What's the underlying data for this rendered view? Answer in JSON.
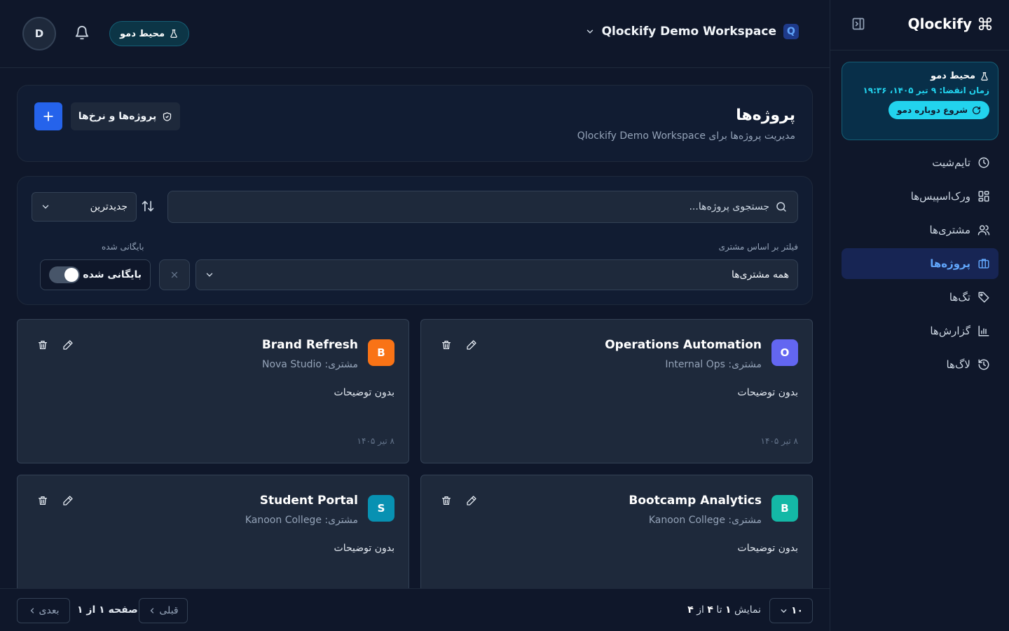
{
  "brand": {
    "name": "Qlockify"
  },
  "demo": {
    "title": "محیط دمو",
    "expiry": "زمان انقضا: ۹ تیر ۱۴۰۵، ۱۹:۳۶",
    "restart_label": "شروع دوباره دمو"
  },
  "nav": [
    {
      "label": "تایم‌شیت",
      "icon": "clock-icon"
    },
    {
      "label": "ورک‌اسپیس‌ها",
      "icon": "grid-icon"
    },
    {
      "label": "مشتری‌ها",
      "icon": "users-icon"
    },
    {
      "label": "پروژه‌ها",
      "icon": "briefcase-icon",
      "active": true
    },
    {
      "label": "تگ‌ها",
      "icon": "tag-icon"
    },
    {
      "label": "گزارش‌ها",
      "icon": "bar-chart-icon"
    },
    {
      "label": "لاگ‌ها",
      "icon": "history-icon"
    }
  ],
  "header": {
    "avatar_initial": "D",
    "demo_pill": "محیط دمو",
    "workspace_badge": "Q",
    "workspace_name": "Qlockify Demo Workspace"
  },
  "page": {
    "title": "پروژه‌ها",
    "subtitle": "مدیریت پروژه‌ها برای Qlockify Demo Workspace",
    "rates_button": "پروژه‌ها و نرخ‌ها"
  },
  "filters": {
    "search_placeholder": "جستجوی پروژه‌ها...",
    "sort_value": "جدیدترین",
    "client_label": "فیلتر بر اساس مشتری",
    "client_value": "همه مشتری‌ها",
    "archived_label": "بایگانی شده",
    "archived_toggle_label": "بایگانی شده"
  },
  "projects": [
    {
      "initial": "O",
      "color": "#6366f1",
      "name": "Operations Automation",
      "client": "مشتری: Internal Ops",
      "description": "بدون توضیحات",
      "date": "۸ تیر ۱۴۰۵"
    },
    {
      "initial": "B",
      "color": "#f97316",
      "name": "Brand Refresh",
      "client": "مشتری: Nova Studio",
      "description": "بدون توضیحات",
      "date": "۸ تیر ۱۴۰۵"
    },
    {
      "initial": "B",
      "color": "#14b8a6",
      "name": "Bootcamp Analytics",
      "client": "مشتری: Kanoon College",
      "description": "بدون توضیحات",
      "date": ""
    },
    {
      "initial": "S",
      "color": "#0891b2",
      "name": "Student Portal",
      "client": "مشتری: Kanoon College",
      "description": "بدون توضیحات",
      "date": ""
    }
  ],
  "pagination": {
    "page_size": "۱۰",
    "showing_prefix": "نمایش",
    "from": "۱",
    "to_word": "تا",
    "to": "۴",
    "of_word": "از",
    "total": "۴",
    "page_text": "صفحه ۱ از ۱",
    "prev_label": "قبلی",
    "next_label": "بعدی"
  }
}
